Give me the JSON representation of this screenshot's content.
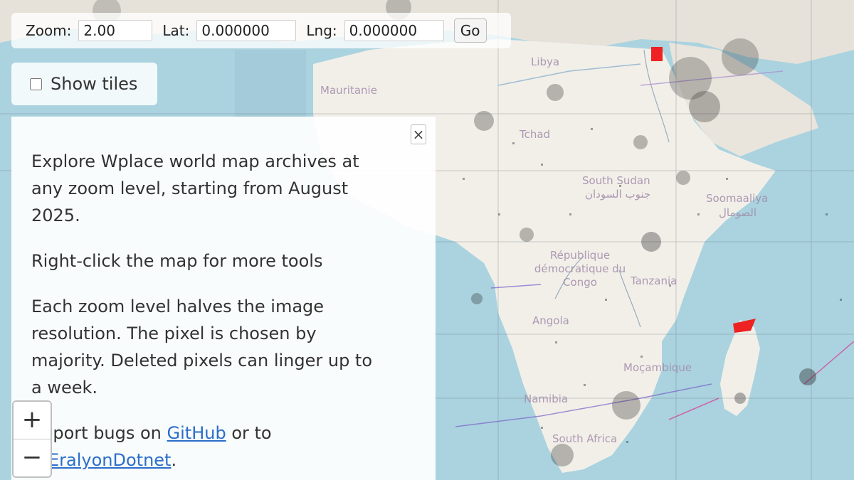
{
  "controls": {
    "zoom_label": "Zoom:",
    "zoom_value": "2.00",
    "lat_label": "Lat:",
    "lat_value": "0.000000",
    "lng_label": "Lng:",
    "lng_value": "0.000000",
    "go_label": "Go"
  },
  "tiles": {
    "label": "Show tiles",
    "checked": false
  },
  "info": {
    "close_glyph": "×",
    "paragraph1": "Explore Wplace world map archives at any zoom level, starting from August 2025.",
    "paragraph2": "Right-click the map for more tools",
    "paragraph3": "Each zoom level halves the image resolution. The pixel is chosen by majority. Deleted pixels can linger up to a week.",
    "paragraph4_prefix": "Report bugs on ",
    "github_link": "GitHub",
    "paragraph4_middle": " or to ",
    "user_link": "@EralyonDotnet",
    "paragraph4_suffix": "."
  },
  "zoom_control": {
    "zoom_in": "+",
    "zoom_out": "−"
  },
  "map_labels": {
    "libya": "Libya",
    "mauritania": "Mauritanie",
    "chad": "Tchad",
    "south_sudan": "South Sudan",
    "south_sudan_ar": "جنوب السودان",
    "somalia": "Soomaaliya",
    "somalia_ar": "الصومال",
    "drc": "République démocratique du Congo",
    "tanzania": "Tanzania",
    "angola": "Angola",
    "mozambique": "Moçambique",
    "namibia": "Namibia",
    "south_africa": "South Africa"
  },
  "colors": {
    "ocean": "#aad3df",
    "land": "#f2efe9",
    "link": "#2a6ec9"
  }
}
